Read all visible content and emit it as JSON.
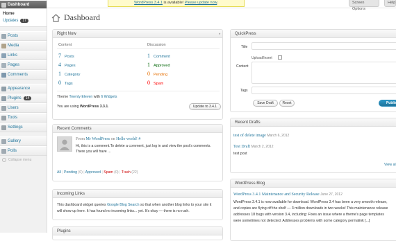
{
  "sidebar": {
    "dashboard_label": "Dashboard",
    "home_label": "Home",
    "updates_label": "Updates",
    "updates_count": "17",
    "items": [
      {
        "label": "Posts",
        "icon": "pin-icon"
      },
      {
        "label": "Media",
        "icon": "media-icon"
      },
      {
        "label": "Links",
        "icon": "link-icon"
      },
      {
        "label": "Pages",
        "icon": "page-icon"
      },
      {
        "label": "Comments",
        "icon": "comment-icon"
      },
      {
        "label": "Appearance",
        "icon": "appearance-icon"
      },
      {
        "label": "Plugins",
        "icon": "plug-icon",
        "badge": "14"
      },
      {
        "label": "Users",
        "icon": "users-icon"
      },
      {
        "label": "Tools",
        "icon": "tools-icon"
      },
      {
        "label": "Settings",
        "icon": "settings-icon"
      },
      {
        "label": "Gallery",
        "icon": "gallery-icon"
      },
      {
        "label": "Polls",
        "icon": "polls-icon"
      }
    ],
    "collapse_label": "Collapse menu"
  },
  "topbar": {
    "nag_prefix": "WordPress 3.4.1",
    "nag_middle": " is available! ",
    "nag_link": "Please update now",
    "nag_end": ".",
    "screen_options": "Screen Options",
    "help": "Help"
  },
  "page_title": "Dashboard",
  "right_now": {
    "title": "Right Now",
    "content_heading": "Content",
    "discussion_heading": "Discussion",
    "content_rows": [
      {
        "num": "7",
        "label": "Posts"
      },
      {
        "num": "4",
        "label": "Pages"
      },
      {
        "num": "1",
        "label": "Category"
      },
      {
        "num": "0",
        "label": "Tags"
      }
    ],
    "discussion_rows": [
      {
        "num": "1",
        "label": "Comment",
        "color": "#21759b"
      },
      {
        "num": "1",
        "label": "Approved",
        "color": "#006505"
      },
      {
        "num": "0",
        "label": "Pending",
        "color": "#e66f00"
      },
      {
        "num": "0",
        "label": "Spam",
        "color": "#ff0000"
      }
    ],
    "theme_prefix": "Theme ",
    "theme_name": "Twenty Eleven",
    "theme_middle": " with ",
    "widgets_link": "6 Widgets",
    "version_prefix": "You are using ",
    "version": "WordPress 3.3.1",
    "version_suffix": ".",
    "update_button": "Update to 3.4.1"
  },
  "recent_comments": {
    "title": "Recent Comments",
    "from": "From ",
    "author": "Mr WordPress",
    "on": " on ",
    "post": "Hello world!",
    "hash": " #",
    "body_line1": "Hi, this is a comment.To delete a comment, just log in and view the post's comments.",
    "body_line2": "There you will have ...",
    "filters": [
      {
        "label": "All",
        "count": ""
      },
      {
        "label": "Pending",
        "count": "(0)"
      },
      {
        "label": "Approved",
        "count": ""
      },
      {
        "label": "Spam",
        "count": "(0)"
      },
      {
        "label": "Trash",
        "count": "(22)"
      }
    ]
  },
  "incoming_links": {
    "title": "Incoming Links",
    "line1_prefix": "This dashboard widget queries ",
    "line1_link": "Google Blog Search",
    "line1_suffix": " so that when another blog links to your site it",
    "line2": "will show up here. It has found no incoming links... yet. It's okay — there is no rush."
  },
  "plugins_box_title": "Plugins",
  "quickpress": {
    "title": "QuickPress",
    "title_label": "Title",
    "upload_label": "Upload/Insert",
    "content_label": "Content",
    "tags_label": "Tags",
    "save_draft": "Save Draft",
    "reset": "Reset",
    "publish": "Publish"
  },
  "recent_drafts": {
    "title": "Recent Drafts",
    "drafts": [
      {
        "title": "test of delete image",
        "date": "March 6, 2012",
        "excerpt": ""
      },
      {
        "title": "Test Draft",
        "date": "March 2, 2012",
        "excerpt": "test post"
      }
    ],
    "view_all": "View al"
  },
  "wp_blog": {
    "title": "WordPress Blog",
    "post_title": "WordPress 3.4.1 Maintenance and Security Release",
    "post_date": "June 27, 2012",
    "lines": [
      "WordPress 3.4.1 is now available for download. WordPress 3.4 has been a very smooth release,",
      "and copies are flying off the shelf — 3 million downloads in two weeks! This maintenance release",
      "addresses 18 bugs with version 3.4, including: Fixes an issue where a theme's page templates",
      "were sometimes not detected. Addresses problems with some category permalink [...]"
    ]
  }
}
